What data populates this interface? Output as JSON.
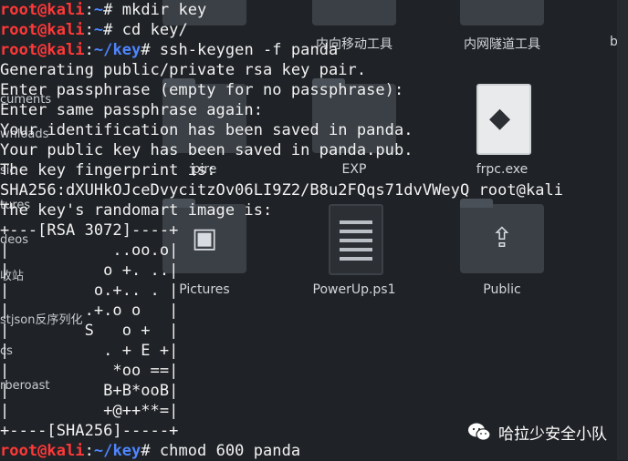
{
  "file_manager": {
    "labels": {
      "mobile_tool": "内向移动工具",
      "tunnel_tool": "内网隧道工具",
      "cut_right": "be",
      "vampire": "pire",
      "exp": "EXP",
      "frpc": "frpc.exe",
      "pictures": "Pictures",
      "powerup": "PowerUp.ps1",
      "public": "Public",
      "cut_s": "s"
    },
    "sidebar": [
      "cuments",
      "wnloads",
      "sic",
      "tures",
      "deos",
      "收站",
      "stjson反序列化",
      "cs",
      "rberoast"
    ]
  },
  "terminal": {
    "lines": [
      {
        "type": "cmd",
        "user": "root@kali",
        "sep": ":",
        "path": "~",
        "sym": "# ",
        "text": "mkdir key"
      },
      {
        "type": "cmd",
        "user": "root@kali",
        "sep": ":",
        "path": "~",
        "sym": "# ",
        "text": "cd key/"
      },
      {
        "type": "cmd",
        "user": "root@kali",
        "sep": ":",
        "path": "~/key",
        "sym": "# ",
        "text": "ssh-keygen -f panda"
      },
      {
        "type": "out",
        "text": "Generating public/private rsa key pair."
      },
      {
        "type": "out",
        "text": "Enter passphrase (empty for no passphrase):"
      },
      {
        "type": "out",
        "text": "Enter same passphrase again:"
      },
      {
        "type": "out",
        "text": "Your identification has been saved in panda."
      },
      {
        "type": "out",
        "text": "Your public key has been saved in panda.pub."
      },
      {
        "type": "out",
        "text": "The key fingerprint is:"
      },
      {
        "type": "out",
        "text": "SHA256:dXUHkOJceDvycitzOv06LI9Z2/B8u2FQqs71dvVWeyQ root@kali"
      },
      {
        "type": "out",
        "text": "The key's randomart image is:"
      },
      {
        "type": "out",
        "text": "+---[RSA 3072]----+"
      },
      {
        "type": "out",
        "text": "|           ..oo.o|"
      },
      {
        "type": "out",
        "text": "|          o +. ..|"
      },
      {
        "type": "out",
        "text": "|         o.+.. . |"
      },
      {
        "type": "out",
        "text": "|        .+.o o   |"
      },
      {
        "type": "out",
        "text": "|        S   o +  |"
      },
      {
        "type": "out",
        "text": "|          . + E +|"
      },
      {
        "type": "out",
        "text": "|           *oo ==|"
      },
      {
        "type": "out",
        "text": "|          B+B*ooB|"
      },
      {
        "type": "out",
        "text": "|          +@++**=|"
      },
      {
        "type": "out",
        "text": "+----[SHA256]-----+"
      },
      {
        "type": "cmd",
        "user": "root@kali",
        "sep": ":",
        "path": "~/key",
        "sym": "# ",
        "text": "chmod 600 panda"
      }
    ]
  },
  "watermark": {
    "text": "哈拉少安全小队",
    "icon": "wechat-icon"
  },
  "colors": {
    "prompt_user": "#ff3838",
    "prompt_path": "#4d86ff",
    "text": "#f2f2f2",
    "background": "#1f2226"
  }
}
